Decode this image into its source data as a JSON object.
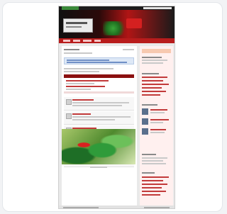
{
  "site": {
    "title": "",
    "login_label": "",
    "search_placeholder": ""
  },
  "nav": {
    "items": [
      "",
      "",
      "",
      ""
    ]
  },
  "colors": {
    "header": "#b81c1c",
    "section": "#8b1010",
    "sidebar": "#fff0ef",
    "notice": "#dde8f6"
  }
}
